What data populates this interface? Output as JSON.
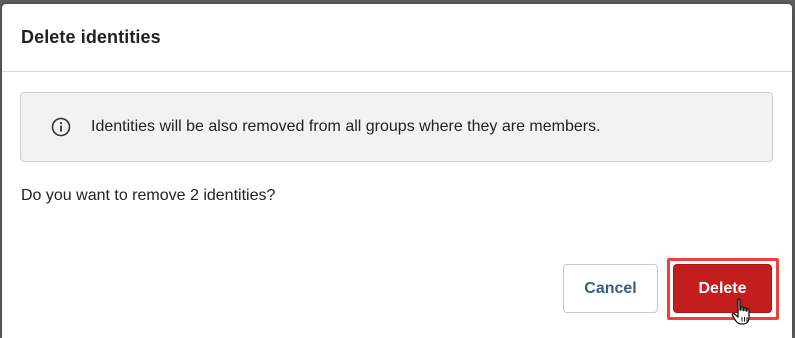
{
  "dialog": {
    "title": "Delete identities",
    "alert_text": "Identities will be also removed from all groups where they are members.",
    "alert_icon": "info-icon",
    "question": "Do you want to remove 2 identities?",
    "cancel_label": "Cancel",
    "delete_label": "Delete"
  },
  "colors": {
    "delete_button": "#c41d1d",
    "cancel_text": "#3d5a8a",
    "highlight": "#f23e3e"
  }
}
